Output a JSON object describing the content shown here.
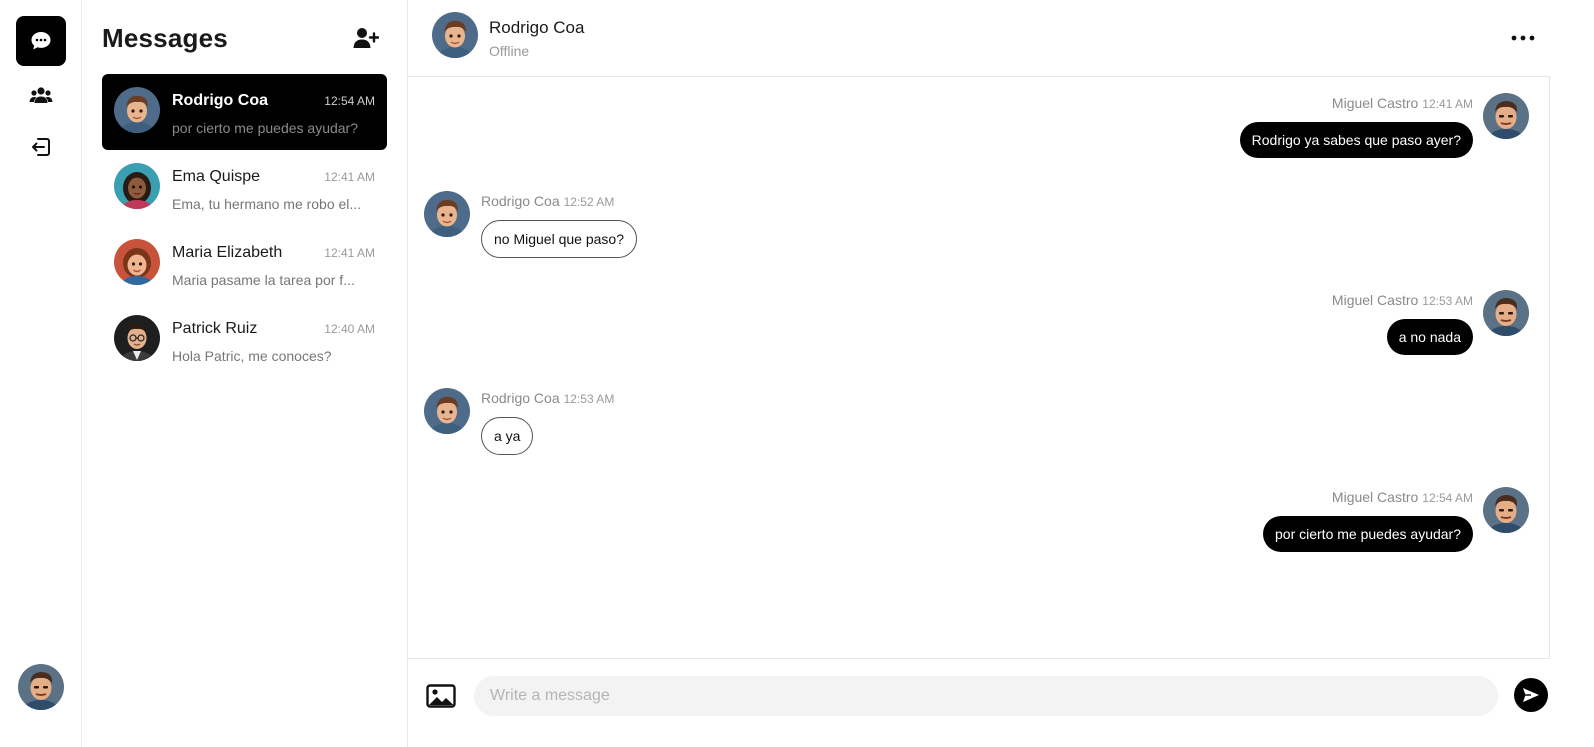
{
  "rail": {
    "items": [
      {
        "icon": "chat-bubble-icon",
        "active": true
      },
      {
        "icon": "users-icon",
        "active": false
      },
      {
        "icon": "logout-icon",
        "active": false
      }
    ],
    "current_user_avatar": "avatar-miguel"
  },
  "contacts": {
    "title": "Messages",
    "add_icon": "add-user-icon",
    "items": [
      {
        "name": "Rodrigo Coa",
        "time": "12:54 AM",
        "preview": "por cierto me puedes ayudar?",
        "active": true,
        "avatar": "avatar-rodrigo"
      },
      {
        "name": "Ema Quispe",
        "time": "12:41 AM",
        "preview": "Ema, tu hermano me robo el...",
        "active": false,
        "avatar": "avatar-ema"
      },
      {
        "name": "Maria Elizabeth",
        "time": "12:41 AM",
        "preview": "Maria pasame la tarea por f...",
        "active": false,
        "avatar": "avatar-maria"
      },
      {
        "name": "Patrick Ruiz",
        "time": "12:40 AM",
        "preview": "Hola Patric, me conoces?",
        "active": false,
        "avatar": "avatar-patrick"
      }
    ]
  },
  "chat": {
    "title": "Rodrigo Coa",
    "status": "Offline",
    "menu_icon": "more-horizontal-icon",
    "messages": [
      {
        "sender": "Miguel Castro",
        "time": "12:41 AM",
        "text": "Rodrigo ya sabes que paso ayer?",
        "direction": "out"
      },
      {
        "sender": "Rodrigo Coa",
        "time": "12:52 AM",
        "text": "no Miguel que paso?",
        "direction": "in"
      },
      {
        "sender": "Miguel Castro",
        "time": "12:53 AM",
        "text": "a no nada",
        "direction": "out"
      },
      {
        "sender": "Rodrigo Coa",
        "time": "12:53 AM",
        "text": "a ya",
        "direction": "in"
      },
      {
        "sender": "Miguel Castro",
        "time": "12:54 AM",
        "text": "por cierto me puedes ayudar?",
        "direction": "out"
      }
    ]
  },
  "composer": {
    "placeholder": "Write a message",
    "value": "",
    "image_icon": "image-icon",
    "send_icon": "send-icon"
  },
  "colors": {
    "accent": "#000000",
    "muted_text": "#8a8a8a",
    "divider": "#e6e6e6",
    "input_bg": "#f3f3f3"
  }
}
